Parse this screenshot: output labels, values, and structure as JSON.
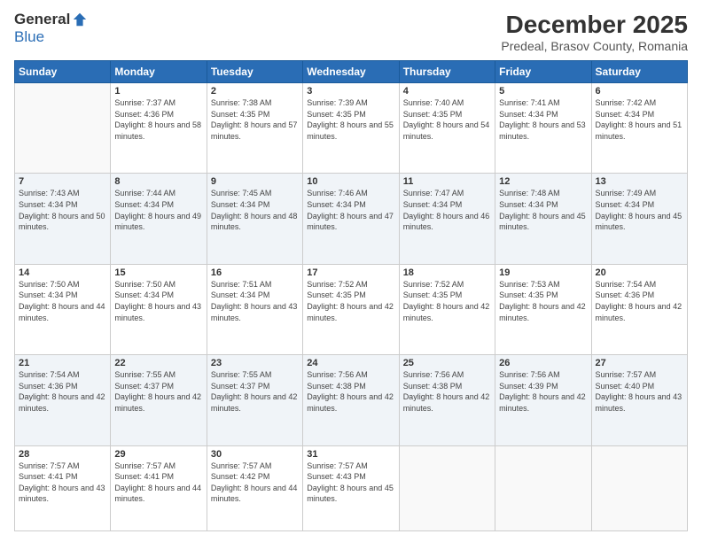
{
  "logo": {
    "general": "General",
    "blue": "Blue"
  },
  "header": {
    "month": "December 2025",
    "location": "Predeal, Brasov County, Romania"
  },
  "weekdays": [
    "Sunday",
    "Monday",
    "Tuesday",
    "Wednesday",
    "Thursday",
    "Friday",
    "Saturday"
  ],
  "weeks": [
    [
      {
        "day": "",
        "sunrise": "",
        "sunset": "",
        "daylight": ""
      },
      {
        "day": "1",
        "sunrise": "7:37 AM",
        "sunset": "4:36 PM",
        "daylight": "8 hours and 58 minutes."
      },
      {
        "day": "2",
        "sunrise": "7:38 AM",
        "sunset": "4:35 PM",
        "daylight": "8 hours and 57 minutes."
      },
      {
        "day": "3",
        "sunrise": "7:39 AM",
        "sunset": "4:35 PM",
        "daylight": "8 hours and 55 minutes."
      },
      {
        "day": "4",
        "sunrise": "7:40 AM",
        "sunset": "4:35 PM",
        "daylight": "8 hours and 54 minutes."
      },
      {
        "day": "5",
        "sunrise": "7:41 AM",
        "sunset": "4:34 PM",
        "daylight": "8 hours and 53 minutes."
      },
      {
        "day": "6",
        "sunrise": "7:42 AM",
        "sunset": "4:34 PM",
        "daylight": "8 hours and 51 minutes."
      }
    ],
    [
      {
        "day": "7",
        "sunrise": "7:43 AM",
        "sunset": "4:34 PM",
        "daylight": "8 hours and 50 minutes."
      },
      {
        "day": "8",
        "sunrise": "7:44 AM",
        "sunset": "4:34 PM",
        "daylight": "8 hours and 49 minutes."
      },
      {
        "day": "9",
        "sunrise": "7:45 AM",
        "sunset": "4:34 PM",
        "daylight": "8 hours and 48 minutes."
      },
      {
        "day": "10",
        "sunrise": "7:46 AM",
        "sunset": "4:34 PM",
        "daylight": "8 hours and 47 minutes."
      },
      {
        "day": "11",
        "sunrise": "7:47 AM",
        "sunset": "4:34 PM",
        "daylight": "8 hours and 46 minutes."
      },
      {
        "day": "12",
        "sunrise": "7:48 AM",
        "sunset": "4:34 PM",
        "daylight": "8 hours and 45 minutes."
      },
      {
        "day": "13",
        "sunrise": "7:49 AM",
        "sunset": "4:34 PM",
        "daylight": "8 hours and 45 minutes."
      }
    ],
    [
      {
        "day": "14",
        "sunrise": "7:50 AM",
        "sunset": "4:34 PM",
        "daylight": "8 hours and 44 minutes."
      },
      {
        "day": "15",
        "sunrise": "7:50 AM",
        "sunset": "4:34 PM",
        "daylight": "8 hours and 43 minutes."
      },
      {
        "day": "16",
        "sunrise": "7:51 AM",
        "sunset": "4:34 PM",
        "daylight": "8 hours and 43 minutes."
      },
      {
        "day": "17",
        "sunrise": "7:52 AM",
        "sunset": "4:35 PM",
        "daylight": "8 hours and 42 minutes."
      },
      {
        "day": "18",
        "sunrise": "7:52 AM",
        "sunset": "4:35 PM",
        "daylight": "8 hours and 42 minutes."
      },
      {
        "day": "19",
        "sunrise": "7:53 AM",
        "sunset": "4:35 PM",
        "daylight": "8 hours and 42 minutes."
      },
      {
        "day": "20",
        "sunrise": "7:54 AM",
        "sunset": "4:36 PM",
        "daylight": "8 hours and 42 minutes."
      }
    ],
    [
      {
        "day": "21",
        "sunrise": "7:54 AM",
        "sunset": "4:36 PM",
        "daylight": "8 hours and 42 minutes."
      },
      {
        "day": "22",
        "sunrise": "7:55 AM",
        "sunset": "4:37 PM",
        "daylight": "8 hours and 42 minutes."
      },
      {
        "day": "23",
        "sunrise": "7:55 AM",
        "sunset": "4:37 PM",
        "daylight": "8 hours and 42 minutes."
      },
      {
        "day": "24",
        "sunrise": "7:56 AM",
        "sunset": "4:38 PM",
        "daylight": "8 hours and 42 minutes."
      },
      {
        "day": "25",
        "sunrise": "7:56 AM",
        "sunset": "4:38 PM",
        "daylight": "8 hours and 42 minutes."
      },
      {
        "day": "26",
        "sunrise": "7:56 AM",
        "sunset": "4:39 PM",
        "daylight": "8 hours and 42 minutes."
      },
      {
        "day": "27",
        "sunrise": "7:57 AM",
        "sunset": "4:40 PM",
        "daylight": "8 hours and 43 minutes."
      }
    ],
    [
      {
        "day": "28",
        "sunrise": "7:57 AM",
        "sunset": "4:41 PM",
        "daylight": "8 hours and 43 minutes."
      },
      {
        "day": "29",
        "sunrise": "7:57 AM",
        "sunset": "4:41 PM",
        "daylight": "8 hours and 44 minutes."
      },
      {
        "day": "30",
        "sunrise": "7:57 AM",
        "sunset": "4:42 PM",
        "daylight": "8 hours and 44 minutes."
      },
      {
        "day": "31",
        "sunrise": "7:57 AM",
        "sunset": "4:43 PM",
        "daylight": "8 hours and 45 minutes."
      },
      {
        "day": "",
        "sunrise": "",
        "sunset": "",
        "daylight": ""
      },
      {
        "day": "",
        "sunrise": "",
        "sunset": "",
        "daylight": ""
      },
      {
        "day": "",
        "sunrise": "",
        "sunset": "",
        "daylight": ""
      }
    ]
  ]
}
